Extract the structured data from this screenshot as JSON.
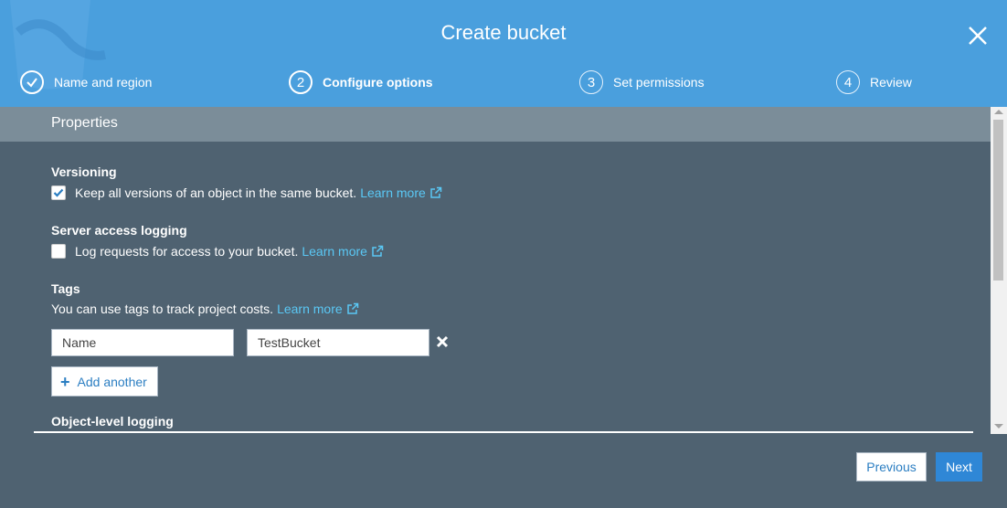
{
  "dialog": {
    "title": "Create bucket"
  },
  "steps": [
    {
      "number": "",
      "label": "Name and region",
      "state": "done"
    },
    {
      "number": "2",
      "label": "Configure options",
      "state": "active"
    },
    {
      "number": "3",
      "label": "Set permissions",
      "state": "inactive"
    },
    {
      "number": "4",
      "label": "Review",
      "state": "inactive"
    }
  ],
  "properties": {
    "header": "Properties"
  },
  "versioning": {
    "title": "Versioning",
    "text": "Keep all versions of an object in the same bucket.",
    "link": "Learn more",
    "checked": true
  },
  "logging": {
    "title": "Server access logging",
    "text": "Log requests for access to your bucket.",
    "link": "Learn more",
    "checked": false
  },
  "tags": {
    "title": "Tags",
    "text": "You can use tags to track project costs.",
    "link": "Learn more",
    "key_value": "Name",
    "value_value": "TestBucket",
    "add_label": "Add another"
  },
  "object_logging": {
    "title": "Object-level logging"
  },
  "footer": {
    "previous_label": "Previous",
    "next_label": "Next"
  },
  "colors": {
    "header": "#4a9fdd",
    "body": "#4f6271",
    "link": "#5ac8f5",
    "primary": "#2f87d6"
  },
  "icons": {
    "close": "close-icon",
    "check": "checkmark-icon",
    "external": "external-link-icon",
    "remove": "remove-tag-icon",
    "add": "plus-icon"
  }
}
